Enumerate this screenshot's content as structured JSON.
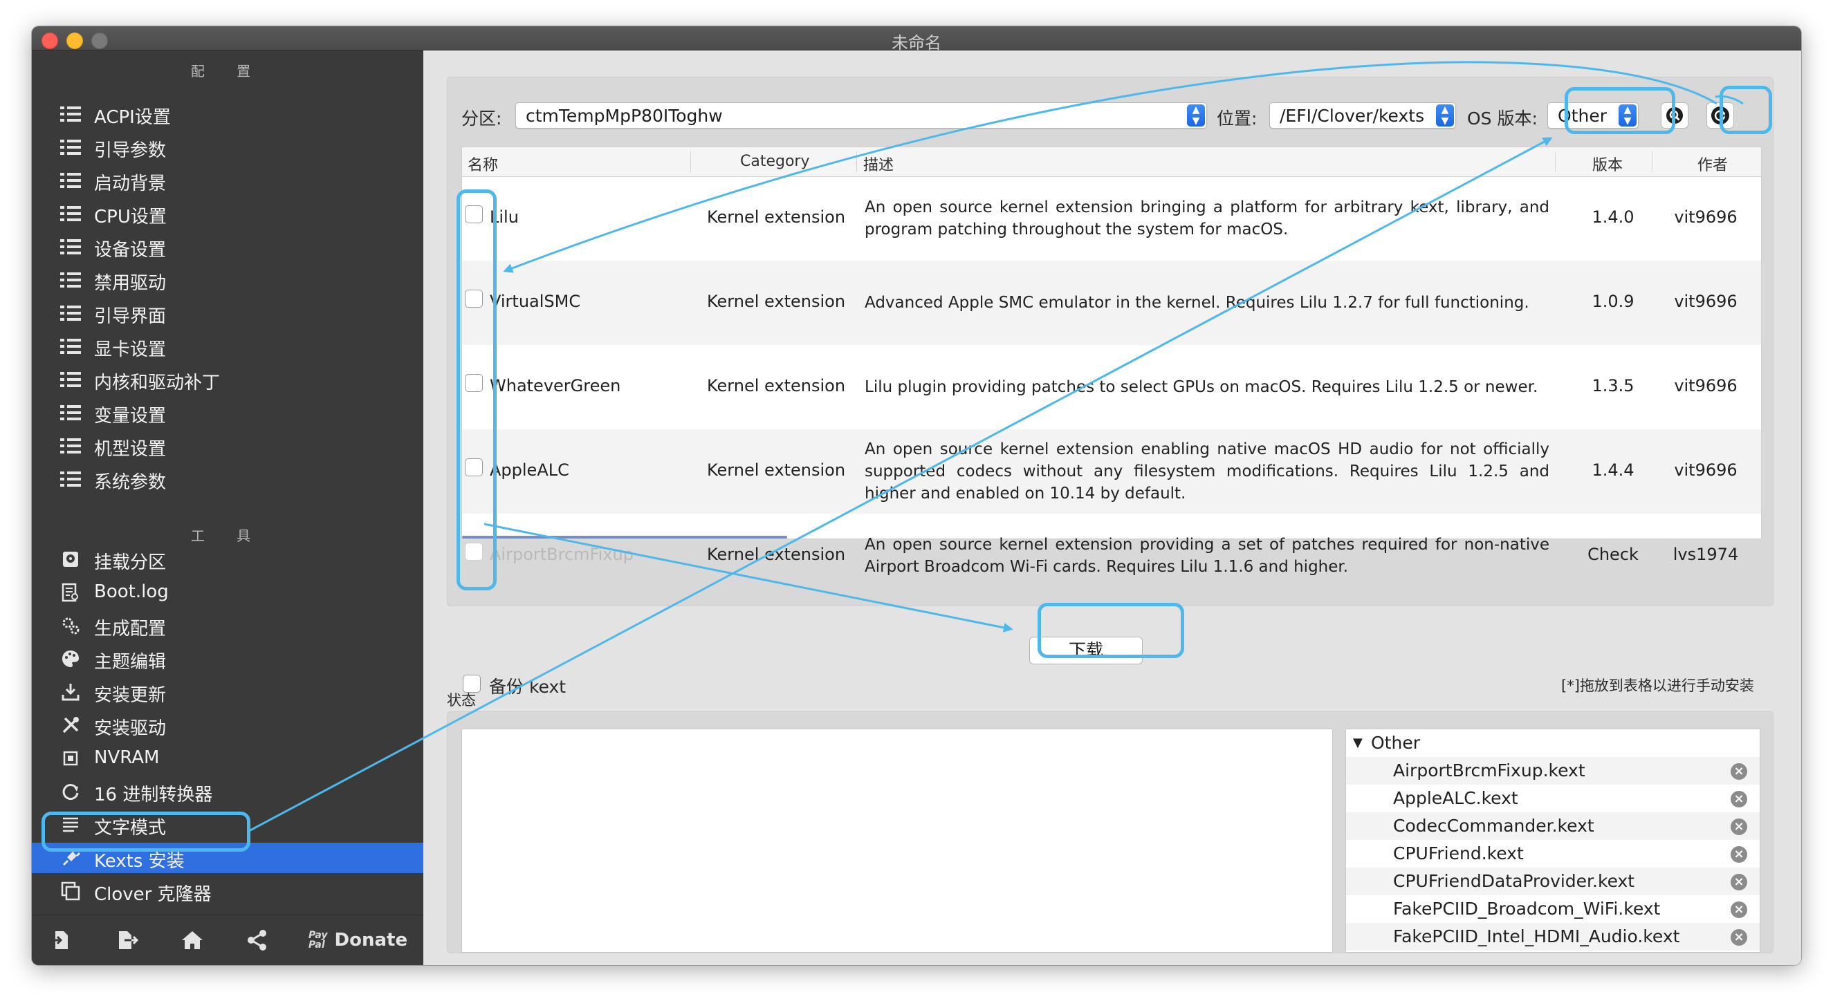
{
  "window": {
    "title": "未命名"
  },
  "sidebar": {
    "config_header": "配 置",
    "config_items": [
      {
        "label": "ACPI设置",
        "icon": "list-icon"
      },
      {
        "label": "引导参数",
        "icon": "list-icon"
      },
      {
        "label": "启动背景",
        "icon": "list-icon"
      },
      {
        "label": "CPU设置",
        "icon": "list-icon"
      },
      {
        "label": "设备设置",
        "icon": "list-icon"
      },
      {
        "label": "禁用驱动",
        "icon": "list-icon"
      },
      {
        "label": "引导界面",
        "icon": "list-icon"
      },
      {
        "label": "显卡设置",
        "icon": "list-icon"
      },
      {
        "label": "内核和驱动补丁",
        "icon": "list-icon"
      },
      {
        "label": "变量设置",
        "icon": "list-icon"
      },
      {
        "label": "机型设置",
        "icon": "list-icon"
      },
      {
        "label": "系统参数",
        "icon": "list-icon"
      }
    ],
    "tools_header": "工 具",
    "tool_items": [
      {
        "label": "挂载分区",
        "icon": "disk-icon"
      },
      {
        "label": "Boot.log",
        "icon": "log-icon"
      },
      {
        "label": "生成配置",
        "icon": "gears-icon"
      },
      {
        "label": "主题编辑",
        "icon": "palette-icon"
      },
      {
        "label": "安装更新",
        "icon": "download-icon"
      },
      {
        "label": "安装驱动",
        "icon": "wrench-icon"
      },
      {
        "label": "NVRAM",
        "icon": "chip-icon"
      },
      {
        "label": "16 进制转换器",
        "icon": "refresh-icon"
      },
      {
        "label": "文字模式",
        "icon": "text-icon"
      },
      {
        "label": "Kexts 安装",
        "icon": "plug-icon",
        "selected": true
      },
      {
        "label": "Clover 克隆器",
        "icon": "clone-icon"
      }
    ],
    "donate_label": "Donate",
    "paypal_text": [
      "Pay",
      "Pal"
    ]
  },
  "toolbar": {
    "partition_label": "分区:",
    "partition_value": "ctmTempMpP80IToghw",
    "location_label": "位置:",
    "location_value": "/EFI/Clover/kexts",
    "os_label": "OS 版本:",
    "os_value": "Other"
  },
  "table": {
    "columns": [
      "名称",
      "Category",
      "描述",
      "版本",
      "作者"
    ],
    "rows": [
      {
        "name": "Lilu",
        "category": "Kernel extension",
        "description": "An open source kernel extension bringing a platform for arbitrary kext, library, and program patching throughout the system for macOS.",
        "version": "1.4.0",
        "author": "vit9696"
      },
      {
        "name": "VirtualSMC",
        "category": "Kernel extension",
        "description": "Advanced Apple SMC emulator in the kernel. Requires Lilu 1.2.7 for full functioning.",
        "version": "1.0.9",
        "author": "vit9696"
      },
      {
        "name": "WhateverGreen",
        "category": "Kernel extension",
        "description": "Lilu plugin providing patches to select GPUs on macOS. Requires Lilu 1.2.5 or newer.",
        "version": "1.3.5",
        "author": "vit9696"
      },
      {
        "name": "AppleALC",
        "category": "Kernel extension",
        "description": "An open source kernel extension enabling native macOS HD audio for not officially supported codecs without any filesystem modifications. Requires Lilu 1.2.5 and higher and enabled on 10.14 by default.",
        "version": "1.4.4",
        "author": "vit9696"
      },
      {
        "name": "AirportBrcmFixup",
        "category": "Kernel extension",
        "description": "An open source kernel extension providing a set of patches required for non-native Airport Broadcom Wi-Fi cards. Requires Lilu 1.1.6 and higher.",
        "version": "Check",
        "author": "lvs1974"
      }
    ]
  },
  "backup_label": "备份 kext",
  "download_label": "下载",
  "drag_hint": "[*]拖放到表格以进行手动安装",
  "status_label": "状态",
  "installed": {
    "group": "Other",
    "items": [
      "AirportBrcmFixup.kext",
      "AppleALC.kext",
      "CodecCommander.kext",
      "CPUFriend.kext",
      "CPUFriendDataProvider.kext",
      "FakePCIID_Broadcom_WiFi.kext",
      "FakePCIID_Intel_HDMI_Audio.kext"
    ]
  },
  "colors": {
    "accent": "#2f6fe0",
    "annotation": "#4fb8ea",
    "sidebar_bg": "#3a3a3a"
  }
}
